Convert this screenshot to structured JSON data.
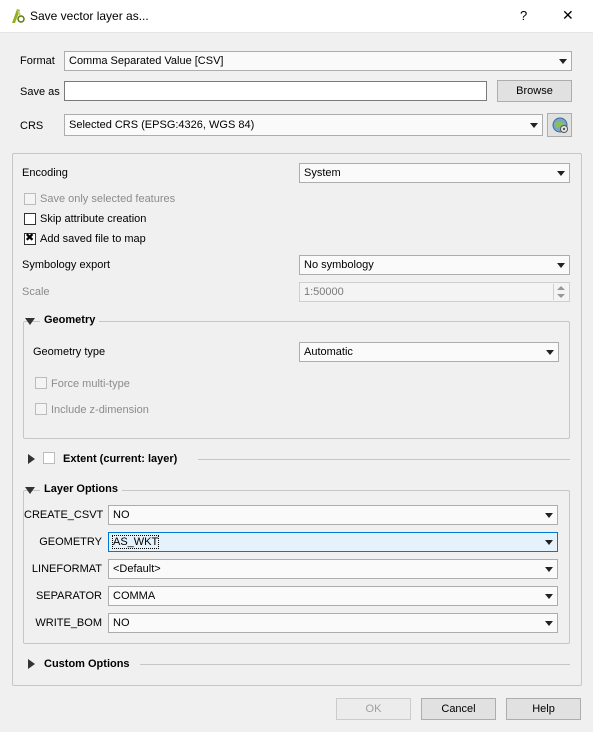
{
  "window": {
    "title": "Save vector layer as...",
    "help_glyph": "?",
    "close_glyph": "✕"
  },
  "form": {
    "format_label": "Format",
    "format_value": "Comma Separated Value [CSV]",
    "saveas_label": "Save as",
    "saveas_value": "",
    "browse_label": "Browse",
    "crs_label": "CRS",
    "crs_value": "Selected CRS (EPSG:4326, WGS 84)"
  },
  "options": {
    "encoding_label": "Encoding",
    "encoding_value": "System",
    "save_selected_label": "Save only selected features",
    "skip_attr_label": "Skip attribute creation",
    "add_saved_label": "Add saved file to map",
    "add_saved_checked": true,
    "symbology_label": "Symbology export",
    "symbology_value": "No symbology",
    "scale_label": "Scale",
    "scale_value": "1:50000"
  },
  "geometry": {
    "title": "Geometry",
    "type_label": "Geometry type",
    "type_value": "Automatic",
    "force_multi_label": "Force multi-type",
    "include_z_label": "Include z-dimension"
  },
  "extent": {
    "title": "Extent (current: layer)"
  },
  "layer_options": {
    "title": "Layer Options",
    "rows": [
      {
        "label": "CREATE_CSVT",
        "value": "NO"
      },
      {
        "label": "GEOMETRY",
        "value": "AS_WKT"
      },
      {
        "label": "LINEFORMAT",
        "value": "<Default>"
      },
      {
        "label": "SEPARATOR",
        "value": "COMMA"
      },
      {
        "label": "WRITE_BOM",
        "value": "NO"
      }
    ]
  },
  "custom_options": {
    "title": "Custom Options"
  },
  "buttons": {
    "ok": "OK",
    "cancel": "Cancel",
    "help": "Help"
  },
  "colors": {
    "accent": "#0078d7",
    "qgis_green": "#93b023"
  }
}
